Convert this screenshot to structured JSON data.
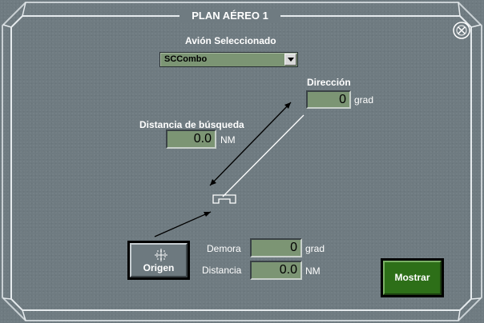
{
  "window": {
    "title": "PLAN AÉREO 1"
  },
  "aircraft": {
    "label": "Avión Seleccionado",
    "selected": "SCCombo"
  },
  "direction": {
    "label": "Dirección",
    "value": "0",
    "unit": "grad"
  },
  "search_distance": {
    "label": "Distancia de búsqueda",
    "value": "0.0",
    "unit": "NM"
  },
  "origin": {
    "button_label": "Origen"
  },
  "bearing": {
    "label": "Demora",
    "value": "0",
    "unit": "grad"
  },
  "distance": {
    "label": "Distancia",
    "value": "0.0",
    "unit": "NM"
  },
  "actions": {
    "show_label": "Mostrar"
  },
  "icons": {
    "close": "close-circle-icon",
    "origin": "crosshair-icon",
    "aircraft_symbol": "aircraft-position-icon"
  },
  "colors": {
    "panel": "#6f7b81",
    "field": "#7c9574",
    "show_button": "#2d6f18",
    "frame": "#e6ebee"
  }
}
